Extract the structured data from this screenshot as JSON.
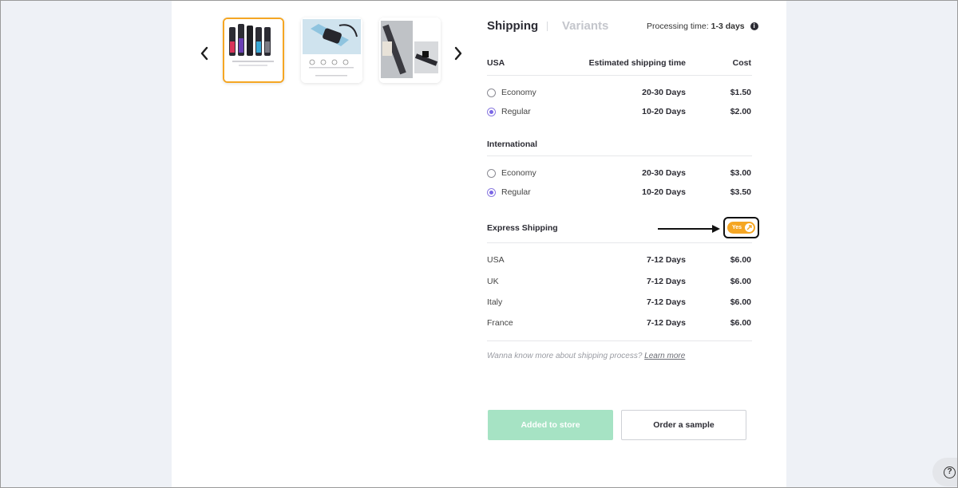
{
  "tabs": [
    {
      "label": "Shipping",
      "active": true
    },
    {
      "label": "Variants",
      "active": false
    }
  ],
  "processing": {
    "label": "Processing time:",
    "value": "1-3 days",
    "icon": "info-icon"
  },
  "table_header": {
    "region": "USA",
    "time": "Estimated shipping time",
    "cost": "Cost"
  },
  "usa_options": [
    {
      "label": "Economy",
      "days": "20-30 Days",
      "cost": "$1.50",
      "checked": false
    },
    {
      "label": "Regular",
      "days": "10-20 Days",
      "cost": "$2.00",
      "checked": true
    }
  ],
  "international": {
    "title": "International",
    "options": [
      {
        "label": "Economy",
        "days": "20-30 Days",
        "cost": "$3.00",
        "checked": false
      },
      {
        "label": "Regular",
        "days": "10-20 Days",
        "cost": "$3.50",
        "checked": true
      }
    ]
  },
  "express": {
    "title": "Express Shipping",
    "toggle_label": "Yes",
    "enabled": true,
    "rows": [
      {
        "country": "USA",
        "days": "7-12 Days",
        "cost": "$6.00"
      },
      {
        "country": "UK",
        "days": "7-12 Days",
        "cost": "$6.00"
      },
      {
        "country": "Italy",
        "days": "7-12 Days",
        "cost": "$6.00"
      },
      {
        "country": "France",
        "days": "7-12 Days",
        "cost": "$6.00"
      }
    ]
  },
  "note": {
    "text": "Wanna know more about shipping process?",
    "link": "Learn more"
  },
  "buttons": {
    "added": "Added to store",
    "sample": "Order a sample"
  },
  "help": {
    "label": "?"
  },
  "colors": {
    "accent": "#f5a623",
    "radio": "#7b67e6",
    "added_btn": "#a6e3c4"
  }
}
